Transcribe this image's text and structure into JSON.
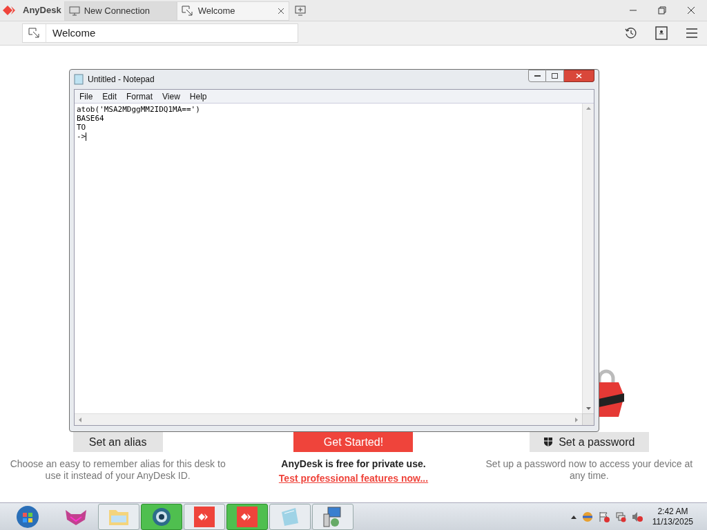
{
  "app": {
    "brand": "AnyDesk"
  },
  "tabs": [
    {
      "label": "New Connection",
      "selected": false,
      "kind": "monitor"
    },
    {
      "label": "Welcome",
      "selected": true,
      "kind": "welcome"
    }
  ],
  "address": {
    "value": "Welcome"
  },
  "notepad": {
    "title": "Untitled - Notepad",
    "menu": [
      "File",
      "Edit",
      "Format",
      "View",
      "Help"
    ],
    "lines": [
      "atob('MSA2MDggMM2IDQ1MA==')",
      "BASE64",
      "TO",
      "->"
    ]
  },
  "actions": [
    {
      "kind": "alias",
      "button": "Set an alias",
      "text": "Choose an easy to remember alias for this desk to use it instead of your AnyDesk ID."
    },
    {
      "kind": "start",
      "button": "Get Started!",
      "text": "AnyDesk is free for private use.",
      "link": "Test professional features now..."
    },
    {
      "kind": "password",
      "button": "Set a password",
      "text": "Set up a password now to access your device at any time."
    }
  ],
  "taskbar": {
    "apps": [
      {
        "kind": "cat",
        "highlighted": false
      },
      {
        "kind": "folder",
        "highlighted": false
      },
      {
        "kind": "browser",
        "highlighted": true
      },
      {
        "kind": "anydesk",
        "highlighted": false
      },
      {
        "kind": "anydesk",
        "highlighted": true
      },
      {
        "kind": "notepad",
        "highlighted": false
      },
      {
        "kind": "network",
        "highlighted": false
      }
    ],
    "time": "2:42 AM",
    "date": "11/13/2025"
  }
}
